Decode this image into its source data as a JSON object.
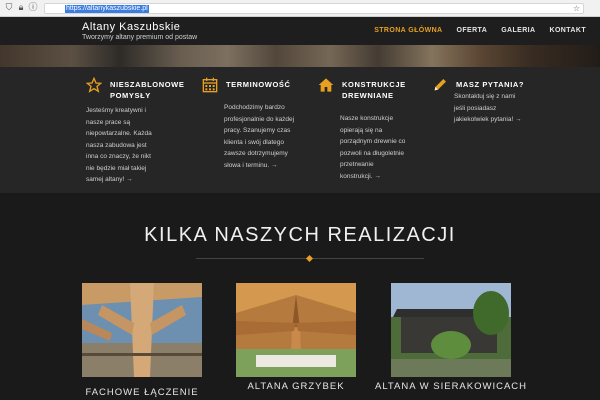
{
  "browser": {
    "url": "https://altanykaszubskie.pl"
  },
  "header": {
    "title": "Altany Kaszubskie",
    "tagline": "Tworzymy altany premium od postaw",
    "nav": [
      "STRONA GŁÓWNA",
      "OFERTA",
      "GALERIA",
      "KONTAKT"
    ]
  },
  "features": [
    {
      "icon": "star-outline-icon",
      "title_lines": [
        "NIESZABLONOWE",
        "POMYSŁY"
      ],
      "text_lines": [
        "Jesteśmy kreatywni i",
        "nasze prace są",
        "niepowtarzalne. Każda",
        "nasza zabudowa jest",
        "inna co znaczy, że nikt",
        "nie będzie miał takiej",
        "samej altany! →"
      ]
    },
    {
      "icon": "calendar-icon",
      "title_lines": [
        "TERMINOWOŚĆ"
      ],
      "text_lines": [
        "Podchodzimy bardzo",
        "profesjonalnie do każdej",
        "pracy. Szanujemy czas",
        "klienta i swój dlatego",
        "zawsze dotrzymujemy",
        "słowa i terminu. →"
      ]
    },
    {
      "icon": "home-icon",
      "title_lines": [
        "KONSTRUKCJE",
        "DREWNIANE"
      ],
      "text_lines": [
        "Nasze konstrukcje",
        "opierają się na",
        "porządnym drewnie co",
        "pozwoli na długoletnie",
        "przetrwanie",
        "konstrukcji. →"
      ]
    },
    {
      "icon": "pencil-icon",
      "title_lines": [
        "MASZ PYTANIA?"
      ],
      "text_lines": [
        "Skontaktuj się z nami",
        "jeśli posiadasz",
        "jakiekolwiek pytania! →"
      ]
    }
  ],
  "section": {
    "title": "KILKA NASZYCH REALIZACJI"
  },
  "gallery": [
    {
      "caption": "FACHOWE ŁĄCZENIE"
    },
    {
      "caption": "ALTANA GRZYBEK"
    },
    {
      "caption": "ALTANA W SIERAKOWICACH"
    }
  ],
  "colors": {
    "accent": "#e8a020",
    "background": "#1a1a1a",
    "feature_band": "#262626"
  }
}
